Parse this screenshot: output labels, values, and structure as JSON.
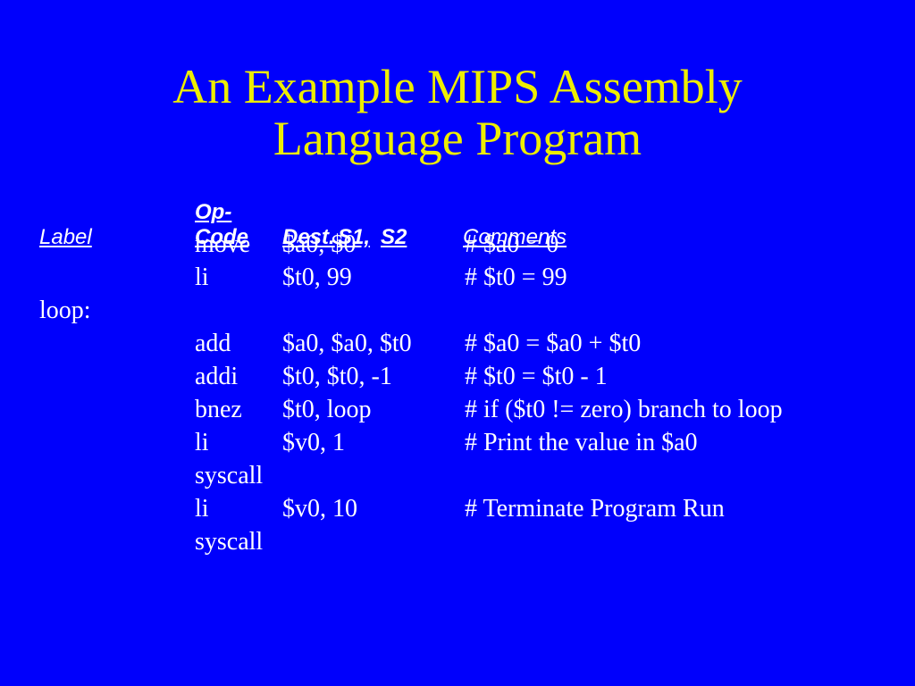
{
  "title_line1": "An Example MIPS Assembly",
  "title_line2": "Language Program",
  "headers": {
    "label": "Label",
    "op": "Op-Code",
    "dest": "Dest.",
    "s1": "S1,",
    "s2": "S2",
    "comments": "Comments"
  },
  "rows": [
    {
      "label": "",
      "op": "move",
      "args": "$a0, $0",
      "comment": "# $a0 = 0"
    },
    {
      "label": "",
      "op": "li",
      "args": "$t0, 99",
      "comment": "# $t0 = 99"
    },
    {
      "label": "loop:",
      "op": "",
      "args": "",
      "comment": ""
    },
    {
      "label": "",
      "op": "add",
      "args": "$a0, $a0, $t0",
      "comment": "# $a0 = $a0 + $t0"
    },
    {
      "label": "",
      "op": "addi",
      "args": "$t0, $t0, -1",
      "comment": "# $t0 = $t0 - 1"
    },
    {
      "label": "",
      "op": "bnez",
      "args": "$t0, loop",
      "comment": "# if ($t0  != zero) branch to loop"
    },
    {
      "label": "",
      "op": "li",
      "args": "$v0, 1",
      "comment": "# Print the value in $a0"
    },
    {
      "label": "",
      "op": "syscall",
      "args": "",
      "comment": ""
    },
    {
      "label": "",
      "op": "li",
      "args": "$v0, 10",
      "comment": "# Terminate Program Run"
    },
    {
      "label": "",
      "op": "syscall",
      "args": "",
      "comment": ""
    }
  ]
}
